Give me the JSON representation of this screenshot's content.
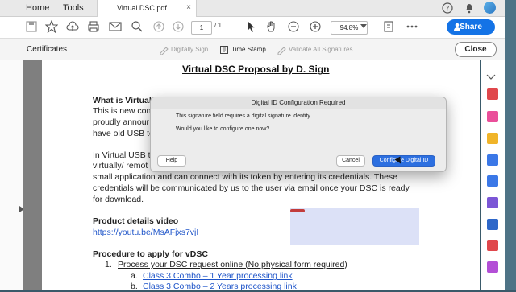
{
  "tabs": {
    "home": "Home",
    "tools": "Tools",
    "active_file": "Virtual DSC.pdf",
    "close_glyph": "×"
  },
  "toolbar": {
    "page_current": "1",
    "page_total": "/ 1",
    "zoom": "94.8%",
    "share_label": "Share"
  },
  "certificates": {
    "label": "Certificates",
    "digitally_sign": "Digitally Sign",
    "time_stamp": "Time Stamp",
    "validate_all": "Validate All Signatures",
    "close_label": "Close"
  },
  "document": {
    "title": "Virtual DSC Proposal by D. Sign",
    "what_is_heading": "What is Virtual",
    "line1": "This is new con",
    "line2": "proudly annour",
    "line3": "have old USB to",
    "line4": "In Virtual USB t",
    "line5": "virtually/ remot",
    "line6": "small application and can connect with its token by entering its credentials. These",
    "line7": "credentials will be communicated by us to the user via email once your DSC is ready",
    "line8": "for download.",
    "product_heading": "Product details video",
    "video_link": "https://youtu.be/MsAFjxs7vjI",
    "procedure_heading": "Procedure to apply for vDSC",
    "step1_num": "1.",
    "step1": "Process your DSC request online (No physical form required)",
    "sub_a_num": "a.",
    "sub_a": "Class 3 Combo – 1 Year processing link",
    "sub_b_num": "b.",
    "sub_b": "Class 3 Combo – 2 Years processing link"
  },
  "dialog": {
    "title": "Digital ID Configuration Required",
    "message1": "This signature field requires a digital signature identity.",
    "message2": "Would you like to configure one now?",
    "help_label": "Help",
    "cancel_label": "Cancel",
    "configure_label": "Configure Digital ID"
  },
  "colors": {
    "accent": "#1473e6",
    "dialog_primary": "#2c6fe0"
  }
}
